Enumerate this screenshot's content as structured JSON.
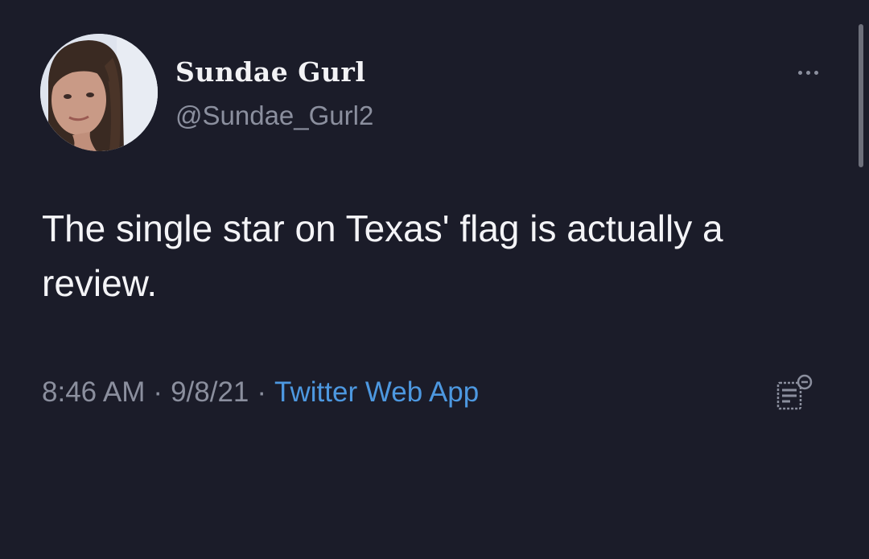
{
  "tweet": {
    "author": {
      "display_name": "Sundae Gurl",
      "handle": "@Sundae_Gurl2"
    },
    "text": "The single star on Texas' flag is actually a review.",
    "time": "8:46 AM",
    "date": "9/8/21",
    "source": "Twitter Web App",
    "separator": "·"
  },
  "colors": {
    "background": "#1b1c29",
    "text_primary": "#f4f4f7",
    "text_secondary": "#8b8f9e",
    "link": "#4d98e0"
  },
  "icons": {
    "more": "more-horizontal-icon",
    "analytics": "analytics-icon"
  }
}
